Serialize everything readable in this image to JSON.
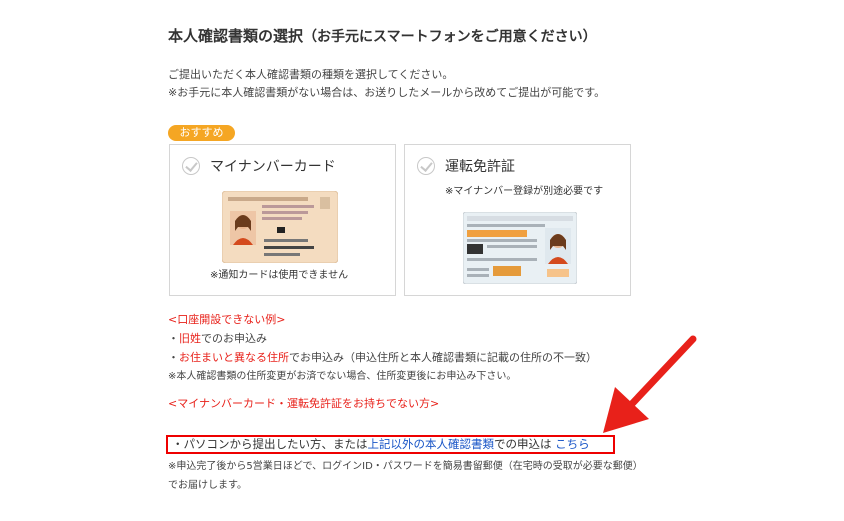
{
  "title": {
    "main": "本人確認書類の選択",
    "sub": "（お手元にスマートフォンをご用意ください）"
  },
  "intro": {
    "line1": "ご提出いただく本人確認書類の種類を選択してください。",
    "line2": "※お手元に本人確認書類がない場合は、お送りしたメールから改めてご提出が可能です。"
  },
  "badge": "おすすめ",
  "cards": [
    {
      "label": "マイナンバーカード",
      "note": "※通知カードは使用できません"
    },
    {
      "label": "運転免許証",
      "note": "※マイナンバー登録が別途必要です"
    }
  ],
  "cannot_open": {
    "heading": "<口座開設できない例>",
    "item1_bullet": "・",
    "item1_red": "旧姓",
    "item1_rest": "でのお申込み",
    "item2_bullet": "・",
    "item2_red": "お住まいと異なる住所",
    "item2_rest": "でお申込み（申込住所と本人確認書類に記載の住所の不一致）",
    "note": "※本人確認書類の住所変更がお済でない場合、住所変更後にお申込み下さい。"
  },
  "no_card": {
    "heading": "<マイナンバーカード・運転免許証をお持ちでない方>",
    "line_start": "・パソコンから提出したい方、または",
    "line_blue": "上記以外の本人確認書類",
    "line_mid": "での申込は",
    "link": "こちら",
    "note": "※申込完了後から5営業日ほどで、ログインID・パスワードを簡易書留郵便（在宅時の受取が必要な郵便）でお届けします。"
  },
  "colors": {
    "accent_orange": "#f5a623",
    "warning_red": "#e8211a",
    "link_blue": "#1a56c7"
  }
}
